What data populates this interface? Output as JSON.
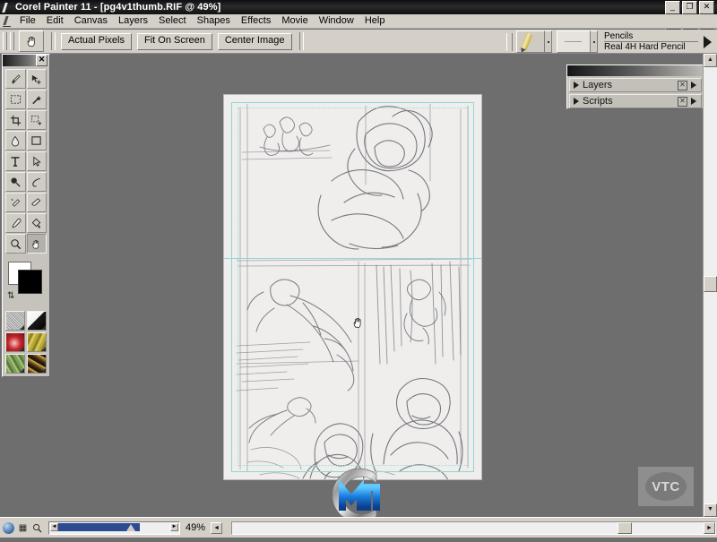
{
  "window": {
    "title": "Corel Painter 11 - [pg4v1thumb.RIF @ 49%]",
    "app_controls": {
      "minimize": "_",
      "restore": "❐",
      "close": "✕"
    },
    "doc_controls": {
      "minimize": "_",
      "restore": "❐",
      "close": "✕"
    }
  },
  "menu": {
    "items": [
      {
        "label": "File"
      },
      {
        "label": "Edit"
      },
      {
        "label": "Canvas"
      },
      {
        "label": "Layers"
      },
      {
        "label": "Select"
      },
      {
        "label": "Shapes"
      },
      {
        "label": "Effects"
      },
      {
        "label": "Movie"
      },
      {
        "label": "Window"
      },
      {
        "label": "Help"
      }
    ]
  },
  "toolbar": {
    "hand_tool_icon": "grabber-hand-icon",
    "buttons": [
      {
        "label": "Actual Pixels"
      },
      {
        "label": "Fit On Screen"
      },
      {
        "label": "Center Image"
      }
    ],
    "brush": {
      "category": "Pencils",
      "variant": "Real 4H Hard Pencil",
      "category_icon": "pencil-icon",
      "expand_arrow": "▶"
    }
  },
  "toolbox": {
    "close_label": "✕",
    "tools": [
      {
        "name": "brush-tool",
        "glyph": "🖌"
      },
      {
        "name": "layer-adjuster-tool",
        "glyph": "✥"
      },
      {
        "name": "rectangular-selection-tool",
        "glyph": "▭"
      },
      {
        "name": "magic-wand-tool",
        "glyph": "✳"
      },
      {
        "name": "crop-tool",
        "glyph": "⌗"
      },
      {
        "name": "selection-adjuster-tool",
        "glyph": "⛶"
      },
      {
        "name": "paint-bucket-tool",
        "glyph": "◭"
      },
      {
        "name": "shape-rectangle-tool",
        "glyph": "□"
      },
      {
        "name": "text-tool",
        "glyph": "T"
      },
      {
        "name": "shape-selection-tool",
        "glyph": "➤"
      },
      {
        "name": "dropper-magnifier-tool",
        "glyph": "◍"
      },
      {
        "name": "pen-tool",
        "glyph": "✎"
      },
      {
        "name": "cloner-tool",
        "glyph": "✣"
      },
      {
        "name": "eraser-tool",
        "glyph": "▱"
      },
      {
        "name": "eyedropper-tool",
        "glyph": "⚲"
      },
      {
        "name": "paint-can-tool",
        "glyph": "◕"
      },
      {
        "name": "magnifier-tool",
        "glyph": "🔍"
      },
      {
        "name": "grabber-hand-tool",
        "glyph": "✋"
      }
    ],
    "colors": {
      "front": "#000000",
      "back": "#ffffff",
      "swap_icon": "swap-colors-icon"
    },
    "selectors": [
      {
        "name": "paper-selector"
      },
      {
        "name": "gradient-selector"
      },
      {
        "name": "pattern-selector"
      },
      {
        "name": "weave-selector"
      },
      {
        "name": "nozzle-selector"
      },
      {
        "name": "look-selector"
      }
    ]
  },
  "right_dock": {
    "close_label": "✕",
    "palettes": [
      {
        "label": "Layers",
        "expand_arrow": "▶",
        "menu_arrow": "▶",
        "icon": "palette-menu-icon"
      },
      {
        "label": "Scripts",
        "expand_arrow": "▶",
        "menu_arrow": "▶",
        "icon": "palette-menu-icon"
      }
    ],
    "scroll_up": "▲",
    "scroll_down": "▼"
  },
  "document": {
    "file_name": "pg4v1thumb.RIF",
    "zoom_percent": "49%",
    "canvas_background": "#efeeec",
    "guide_color": "#8fd8d6",
    "cursor": "grabber-hand-cursor",
    "artwork_description": "Rough graphite comic-page thumbnail sketch with multiple figure panels"
  },
  "status_bar": {
    "zoom_label": "49%",
    "left_arrow": "◄",
    "right_arrow": "►",
    "side_button": "◄",
    "scroll_right": "►",
    "icons": [
      {
        "name": "color-globe-icon"
      },
      {
        "name": "grid-icon",
        "glyph": "▦"
      },
      {
        "name": "magnifier-icon",
        "glyph": "🔍"
      }
    ]
  },
  "overlays": {
    "watermark": "VTC",
    "logo": "corel-painter-logo"
  }
}
